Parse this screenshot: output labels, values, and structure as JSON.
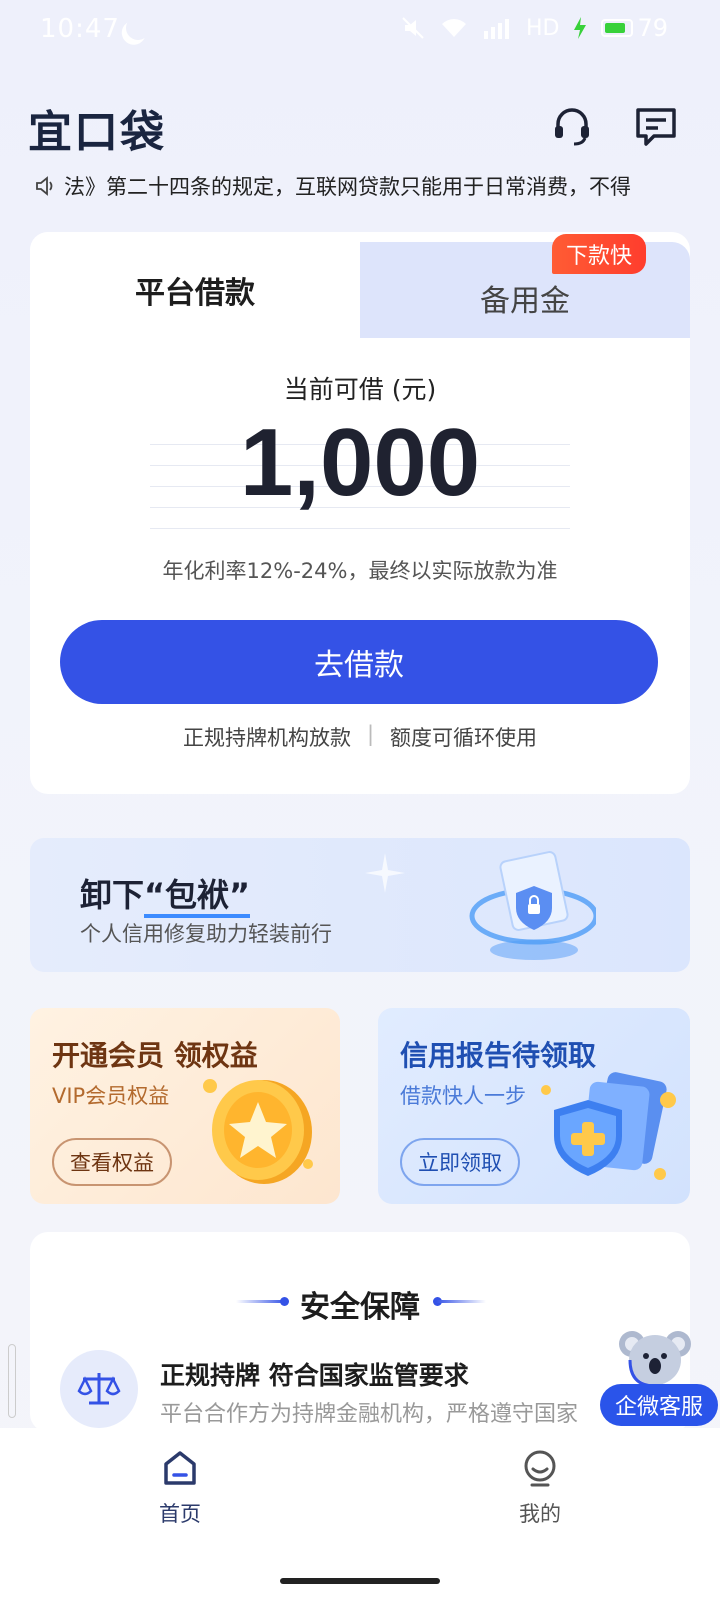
{
  "status_bar": {
    "time": "10:47",
    "network": "HD",
    "battery": "79"
  },
  "header": {
    "logo": "宜口袋"
  },
  "notice": {
    "text": "法》第二十四条的规定，互联网贷款只能用于日常消费，不得"
  },
  "loan_card": {
    "tabs": [
      {
        "label": "平台借款",
        "active": true
      },
      {
        "label": "备用金",
        "active": false
      }
    ],
    "badge": "下款快",
    "available_label": "当前可借 (元)",
    "amount": "1,000",
    "rate_note": "年化利率12%-24%，最终以实际放款为准",
    "borrow_button": "去借款",
    "features": [
      "正规持牌机构放款",
      "额度可循环使用"
    ]
  },
  "banner": {
    "title_prefix": "卸下",
    "title_highlight": "“包袱”",
    "subtitle": "个人信用修复助力轻装前行"
  },
  "promo": {
    "left": {
      "title": "开通会员 领权益",
      "subtitle": "VIP会员权益",
      "button": "查看权益"
    },
    "right": {
      "title": "信用报告待领取",
      "subtitle": "借款快人一步",
      "button": "立即领取"
    }
  },
  "safety": {
    "title": "安全保障",
    "items": [
      {
        "title": "正规持牌 符合国家监管要求",
        "desc": "平台合作方为持牌金融机构，严格遵守国家"
      }
    ]
  },
  "floating_service": {
    "label": "企微客服"
  },
  "bottom_nav": {
    "items": [
      {
        "label": "首页",
        "active": true
      },
      {
        "label": "我的",
        "active": false
      }
    ]
  },
  "colors": {
    "primary": "#3452e6",
    "badge": "#ff4a30",
    "text_dark": "#1d1d1d"
  }
}
